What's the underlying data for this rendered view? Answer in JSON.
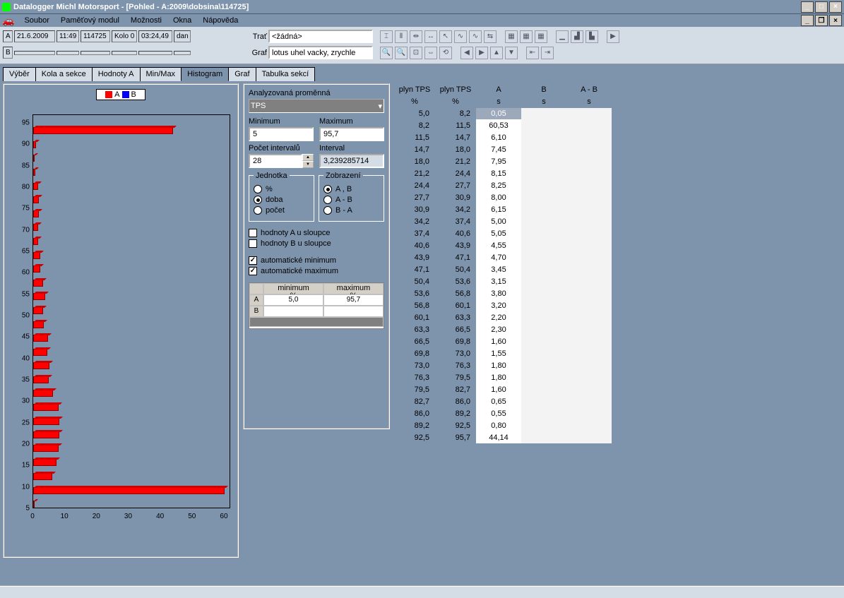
{
  "title": "Datalogger Michl Motorsport - [Pohled  -  A:2009\\dobsina\\114725]",
  "menu": {
    "items": [
      "Soubor",
      "Paměťový modul",
      "Možnosti",
      "Okna",
      "Nápověda"
    ]
  },
  "toolbar_a": {
    "label": "A",
    "date": "21.6.2009",
    "time": "11:49",
    "num": "114725",
    "kolo": "Kolo 0",
    "dur": "03:24,49",
    "drv": "dan"
  },
  "toolbar_b": {
    "label": "B"
  },
  "track_row": {
    "label": "Trať",
    "value": "<žádná>"
  },
  "graf_row": {
    "label": "Graf",
    "value": "lotus uhel vacky, zrychle"
  },
  "tabs": [
    "Výběr",
    "Kola a sekce",
    "Hodnoty A",
    "Min/Max",
    "Histogram",
    "Graf",
    "Tabulka sekcí"
  ],
  "legend": {
    "a": "A",
    "b": "B"
  },
  "params": {
    "var_label": "Analyzovaná proměnná",
    "var_value": "TPS",
    "min_label": "Minimum",
    "min_value": "5",
    "max_label": "Maximum",
    "max_value": "95,7",
    "intcount_label": "Počet intervalů",
    "intcount_value": "28",
    "interval_label": "Interval",
    "interval_value": "3,239285714",
    "unit_legend": "Jednotka",
    "unit_opts": [
      "%",
      "doba",
      "počet"
    ],
    "unit_sel": 1,
    "view_legend": "Zobrazení",
    "view_opts": [
      "A , B",
      "A - B",
      "B - A"
    ],
    "view_sel": 0,
    "cb_a": "hodnoty A u sloupce",
    "cb_b": "hodnoty B u sloupce",
    "cb_automin": "automatické minimum",
    "cb_automax": "automatické maximum",
    "mt_min": "minimum",
    "mt_max": "maximum",
    "mt_unit": "%",
    "mt_a": "A",
    "mt_a_min": "5,0",
    "mt_a_max": "95,7",
    "mt_b": "B"
  },
  "table": {
    "h1": [
      "plyn TPS",
      "plyn TPS",
      "A",
      "B",
      "A - B"
    ],
    "h2": [
      "%",
      "%",
      "s",
      "s",
      "s"
    ],
    "rows": [
      [
        "5,0",
        "8,2",
        "0,05"
      ],
      [
        "8,2",
        "11,5",
        "60,53"
      ],
      [
        "11,5",
        "14,7",
        "6,10"
      ],
      [
        "14,7",
        "18,0",
        "7,45"
      ],
      [
        "18,0",
        "21,2",
        "7,95"
      ],
      [
        "21,2",
        "24,4",
        "8,15"
      ],
      [
        "24,4",
        "27,7",
        "8,25"
      ],
      [
        "27,7",
        "30,9",
        "8,00"
      ],
      [
        "30,9",
        "34,2",
        "6,15"
      ],
      [
        "34,2",
        "37,4",
        "5,00"
      ],
      [
        "37,4",
        "40,6",
        "5,05"
      ],
      [
        "40,6",
        "43,9",
        "4,55"
      ],
      [
        "43,9",
        "47,1",
        "4,70"
      ],
      [
        "47,1",
        "50,4",
        "3,45"
      ],
      [
        "50,4",
        "53,6",
        "3,15"
      ],
      [
        "53,6",
        "56,8",
        "3,80"
      ],
      [
        "56,8",
        "60,1",
        "3,20"
      ],
      [
        "60,1",
        "63,3",
        "2,20"
      ],
      [
        "63,3",
        "66,5",
        "2,30"
      ],
      [
        "66,5",
        "69,8",
        "1,60"
      ],
      [
        "69,8",
        "73,0",
        "1,55"
      ],
      [
        "73,0",
        "76,3",
        "1,80"
      ],
      [
        "76,3",
        "79,5",
        "1,80"
      ],
      [
        "79,5",
        "82,7",
        "1,60"
      ],
      [
        "82,7",
        "86,0",
        "0,65"
      ],
      [
        "86,0",
        "89,2",
        "0,55"
      ],
      [
        "89,2",
        "92,5",
        "0,80"
      ],
      [
        "92,5",
        "95,7",
        "44,14"
      ]
    ]
  },
  "chart_data": {
    "type": "bar",
    "orientation": "horizontal",
    "xlabel": "",
    "ylabel": "",
    "xlim": [
      0,
      62
    ],
    "ylim": [
      5,
      97
    ],
    "x_ticks": [
      0,
      10,
      20,
      30,
      40,
      50,
      60
    ],
    "y_ticks": [
      5,
      10,
      15,
      20,
      25,
      30,
      35,
      40,
      45,
      50,
      55,
      60,
      65,
      70,
      75,
      80,
      85,
      90,
      95
    ],
    "series": [
      {
        "name": "A",
        "color": "#f00",
        "y": [
          5.0,
          8.2,
          11.5,
          14.7,
          18.0,
          21.2,
          24.4,
          27.7,
          30.9,
          34.2,
          37.4,
          40.6,
          43.9,
          47.1,
          50.4,
          53.6,
          56.8,
          60.1,
          63.3,
          66.5,
          69.8,
          73.0,
          76.3,
          79.5,
          82.7,
          86.0,
          89.2,
          92.5
        ],
        "values": [
          0.05,
          60.53,
          6.1,
          7.45,
          7.95,
          8.15,
          8.25,
          8.0,
          6.15,
          5.0,
          5.05,
          4.55,
          4.7,
          3.45,
          3.15,
          3.8,
          3.2,
          2.2,
          2.3,
          1.6,
          1.55,
          1.8,
          1.8,
          1.6,
          0.65,
          0.55,
          0.8,
          44.14
        ]
      },
      {
        "name": "B",
        "color": "#00f",
        "y": [],
        "values": []
      }
    ]
  }
}
